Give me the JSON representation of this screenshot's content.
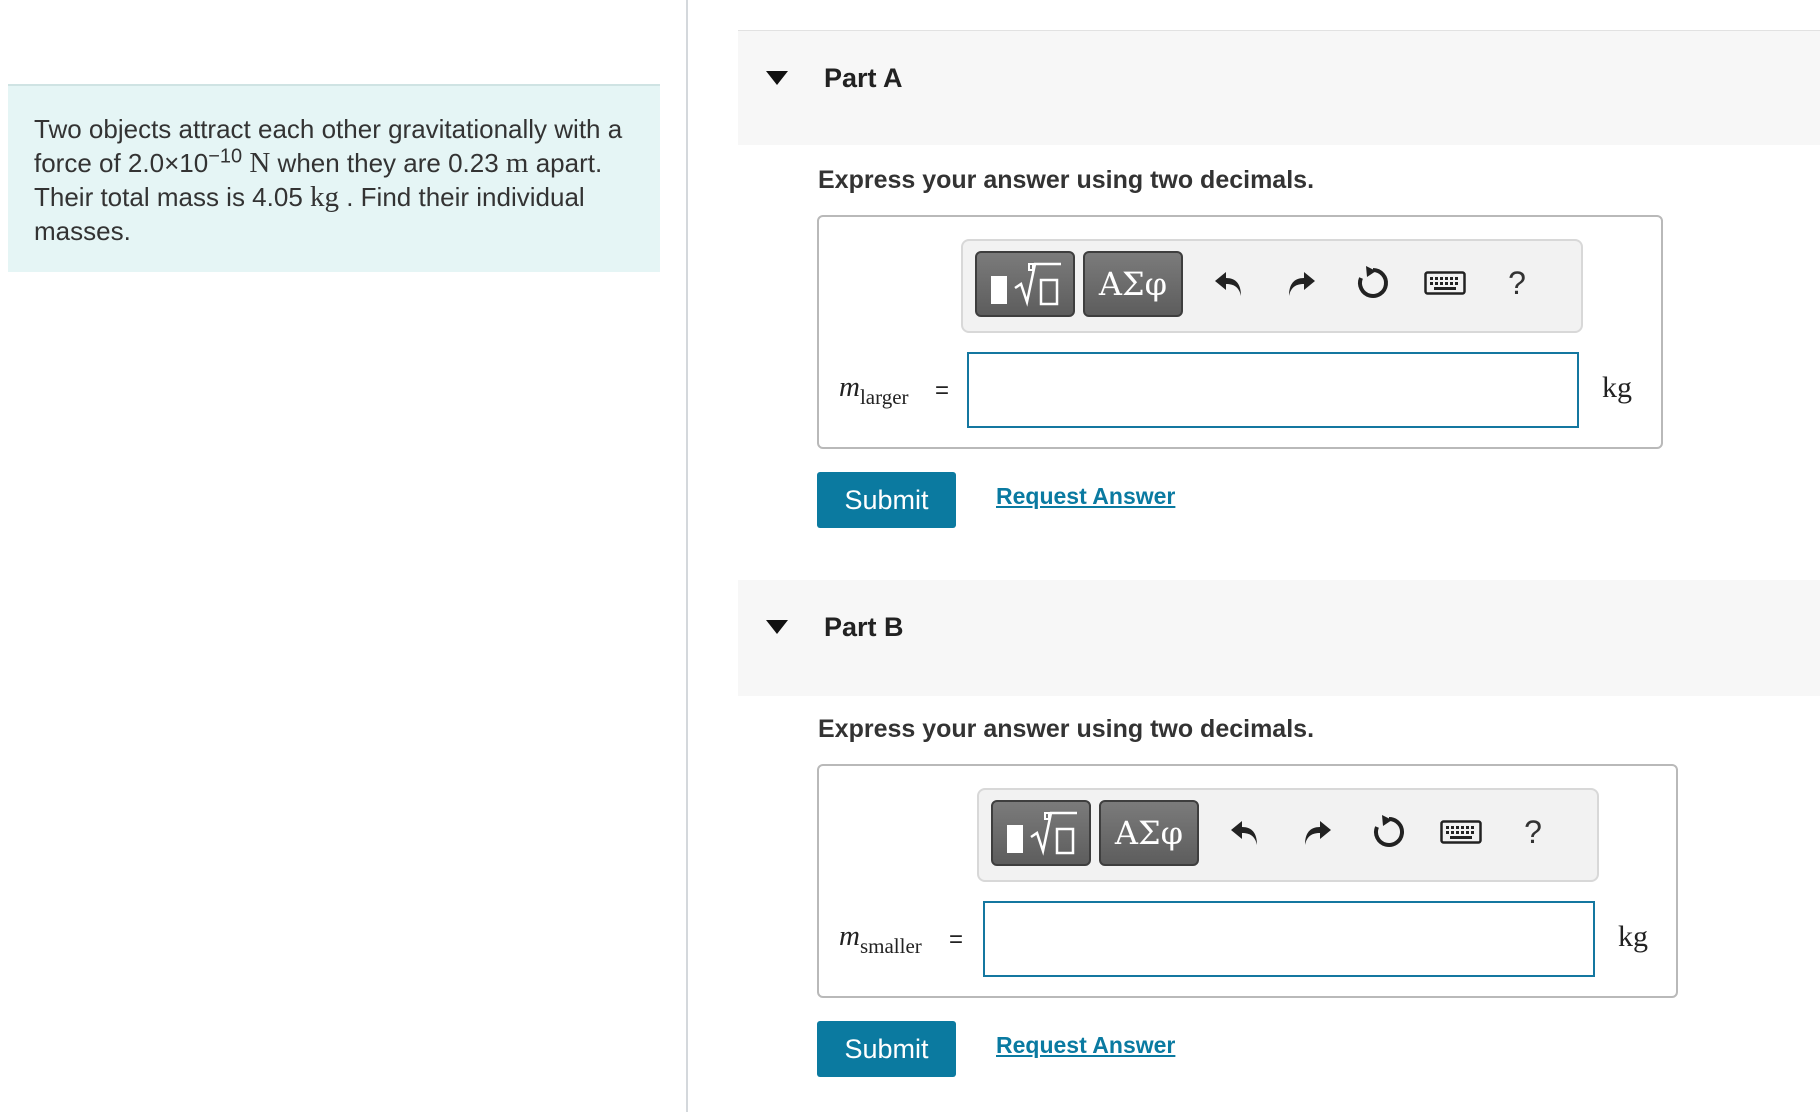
{
  "problem": {
    "line1": "Two objects attract each other gravitationally with a",
    "line2_a": "force of 2.0×10",
    "line2_exp": "−10",
    "line2_unit": "N",
    "line2_b": " when they are 0.23 ",
    "line2_m": "m",
    "line2_c": " apart.",
    "line3_a": "Their total mass is 4.05 ",
    "line3_kg": "kg",
    "line3_b": " . Find their individual",
    "line4": "masses."
  },
  "parts": [
    {
      "title": "Part A",
      "instruction": "Express your answer using two decimals.",
      "var_symbol": "m",
      "var_subscript": "larger",
      "equals": "=",
      "input_value": "",
      "unit": "kg",
      "greek_label": "ΑΣφ",
      "help_label": "?",
      "submit_label": "Submit",
      "request_label": "Request Answer"
    },
    {
      "title": "Part B",
      "instruction": "Express your answer using two decimals.",
      "var_symbol": "m",
      "var_subscript": "smaller",
      "equals": "=",
      "input_value": "",
      "unit": "kg",
      "greek_label": "ΑΣφ",
      "help_label": "?",
      "submit_label": "Submit",
      "request_label": "Request Answer"
    }
  ],
  "icons": {
    "toggle": "caret-down-icon",
    "templates": "templates-icon",
    "greek": "greek-symbols-icon",
    "undo": "undo-icon",
    "redo": "redo-icon",
    "reset": "reset-icon",
    "keyboard": "keyboard-icon",
    "help": "help-icon"
  },
  "colors": {
    "problem_bg": "#e5f5f5",
    "accent": "#0b7aa0",
    "link": "#0a7aa1",
    "input_border": "#1477a0"
  }
}
